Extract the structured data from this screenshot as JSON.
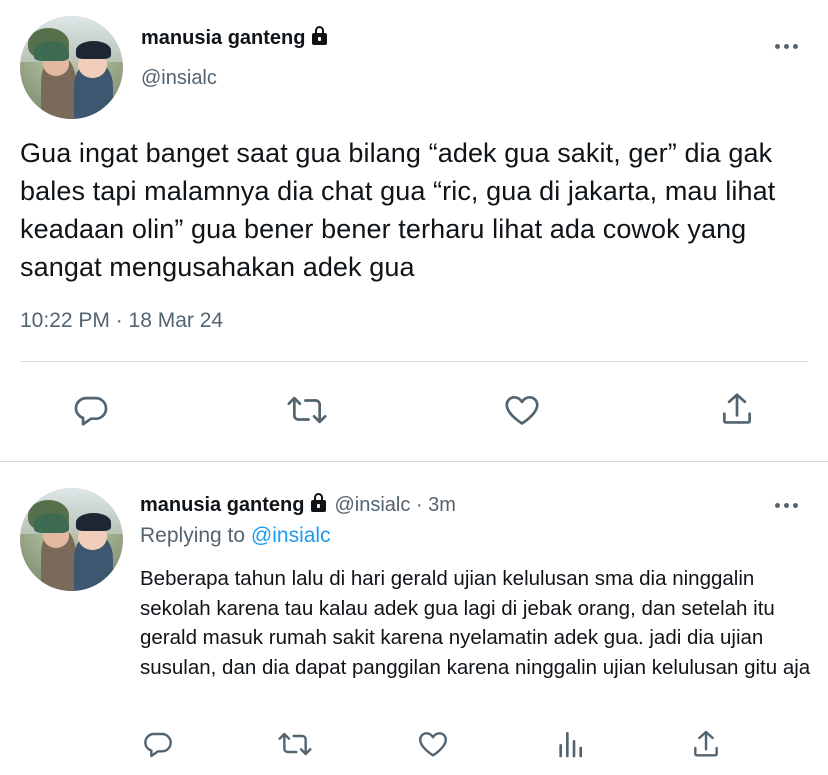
{
  "tweet": {
    "author_name": "manusia ganteng",
    "handle": "@insialc",
    "text": "Gua ingat banget saat gua bilang “adek gua sakit, ger” dia gak bales tapi malamnya dia chat gua “ric, gua di jakarta, mau lihat keadaan olin” gua bener bener terharu lihat ada cowok yang sangat mengusahakan adek gua",
    "timestamp": "10:22 PM · 18 Mar 24",
    "actions": [
      "reply-icon",
      "retweet-icon",
      "like-icon",
      "share-icon"
    ],
    "more_icon": "more-horizontal-icon",
    "lock_icon": "lock-icon"
  },
  "reply": {
    "author_name": "manusia ganteng",
    "handle_time": "@insialc · 3m",
    "replying_prefix": "Replying to",
    "replying_to": "@insialc",
    "text": "Beberapa tahun lalu di hari gerald ujian kelulusan sma dia ninggalin sekolah karena tau kalau adek gua lagi di jebak orang, dan setelah itu gerald masuk rumah sakit karena nyelamatin adek gua. jadi dia ujian susulan, dan dia dapat panggilan karena ninggalin ujian kelulusan gitu aja",
    "actions": [
      "reply-icon",
      "retweet-icon",
      "like-icon",
      "analytics-icon",
      "share-icon"
    ]
  },
  "colors": {
    "text": "#0f1419",
    "secondary": "#536471",
    "link": "#1d9bf0",
    "divider": "#d8dde1"
  }
}
